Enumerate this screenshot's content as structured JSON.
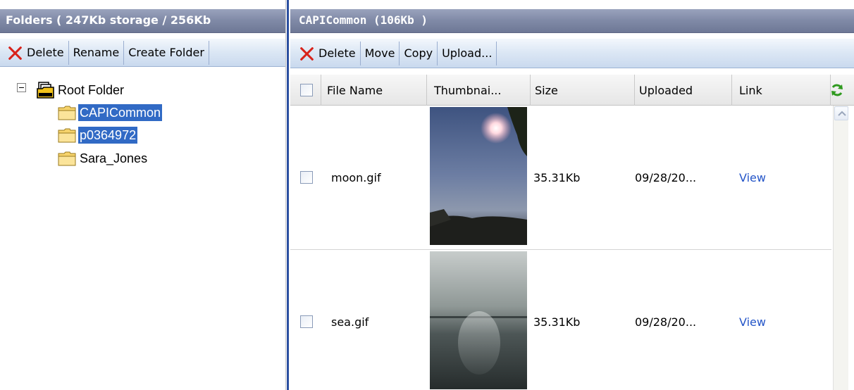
{
  "folders_pane": {
    "title": "Folders ( 247Kb storage / 256Kb",
    "toolbar": {
      "delete_label": "Delete",
      "rename_label": "Rename",
      "create_folder_label": "Create Folder"
    },
    "tree": {
      "root_label": "Root Folder",
      "children": [
        {
          "label": "CAPICommon",
          "selected": true
        },
        {
          "label": "p0364972",
          "selected": true
        },
        {
          "label": "Sara_Jones",
          "selected": false
        }
      ]
    }
  },
  "files_pane": {
    "title": "CAPICommon (106Kb )",
    "toolbar": {
      "delete_label": "Delete",
      "move_label": "Move",
      "copy_label": "Copy",
      "upload_label": "Upload..."
    },
    "columns": {
      "file_name": "File Name",
      "thumbnail": "Thumbnai...",
      "size": "Size",
      "uploaded": "Uploaded",
      "link": "Link"
    },
    "rows": [
      {
        "file_name": "moon.gif",
        "size": "35.31Kb",
        "uploaded": "09/28/20...",
        "link": "View"
      },
      {
        "file_name": "sea.gif",
        "size": "35.31Kb",
        "uploaded": "09/28/20...",
        "link": "View"
      }
    ]
  },
  "icons": {
    "delete": "red-x-icon",
    "root_folder": "root-folder-icon",
    "folder": "folder-icon",
    "refresh": "refresh-icon",
    "scroll_up": "chevron-up-icon"
  },
  "colors": {
    "header_bg": "#7f89a6",
    "selection": "#316ac5",
    "link": "#2455c8",
    "divider": "#2b4fa0"
  }
}
